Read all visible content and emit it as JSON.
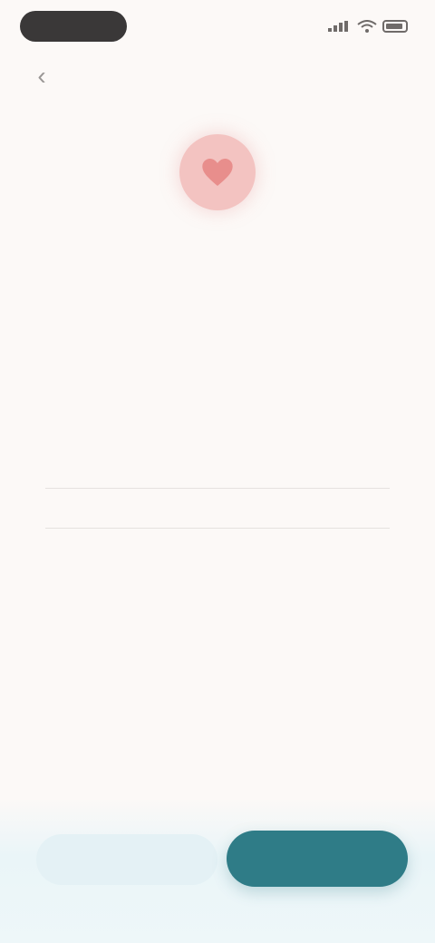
{
  "status_bar": {
    "time": "",
    "icons": [
      "signal-icon",
      "wifi-icon",
      "battery-icon"
    ]
  },
  "nav": {
    "back_icon": "chevron-left-icon"
  },
  "hero": {
    "icon": "heart-icon",
    "icon_color": "#e88e8c",
    "background_color": "#f3c3c1"
  },
  "content": {
    "title": "",
    "subtitle": ""
  },
  "picker": {
    "items": [
      "",
      "",
      "",
      "",
      ""
    ],
    "selected_index": 2
  },
  "actions": {
    "secondary_label": "",
    "primary_label": "",
    "primary_color": "#2f7c87"
  }
}
